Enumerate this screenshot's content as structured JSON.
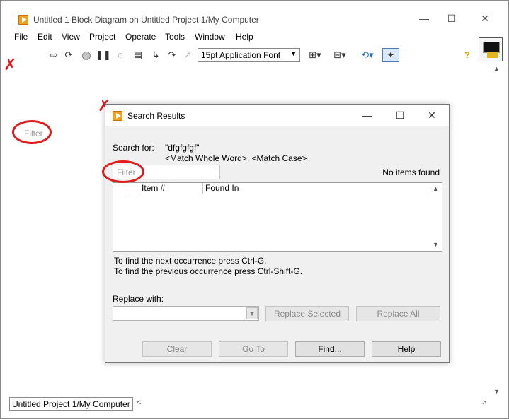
{
  "window": {
    "title": "Untitled 1 Block Diagram on Untitled Project 1/My Computer",
    "minimize": "—",
    "maximize": "☐",
    "close": "✕"
  },
  "menu": [
    "File",
    "Edit",
    "View",
    "Project",
    "Operate",
    "Tools",
    "Window",
    "Help"
  ],
  "toolbar": {
    "font_label": "15pt Application Font",
    "help_icon": "?"
  },
  "canvas": {
    "filter_placeholder": "Filter",
    "project_label": "Untitled Project 1/My Computer"
  },
  "dialog": {
    "title": "Search Results",
    "search_for_label": "Search for:",
    "search_term": "\"dfgfgfgf\"",
    "search_options": "<Match Whole Word>, <Match Case>",
    "filter_placeholder": "Filter",
    "status": "No items found",
    "columns": [
      "Item #",
      "Found In"
    ],
    "hint_next": "To find the next occurrence press Ctrl-G.",
    "hint_prev": "To find the previous occurrence press Ctrl-Shift-G.",
    "replace_label": "Replace with:",
    "replace_value": "",
    "buttons": {
      "replace_selected": "Replace Selected",
      "replace_all": "Replace All",
      "clear": "Clear",
      "goto": "Go To",
      "find": "Find...",
      "help": "Help"
    }
  },
  "annotation_color": "#e01b1b"
}
